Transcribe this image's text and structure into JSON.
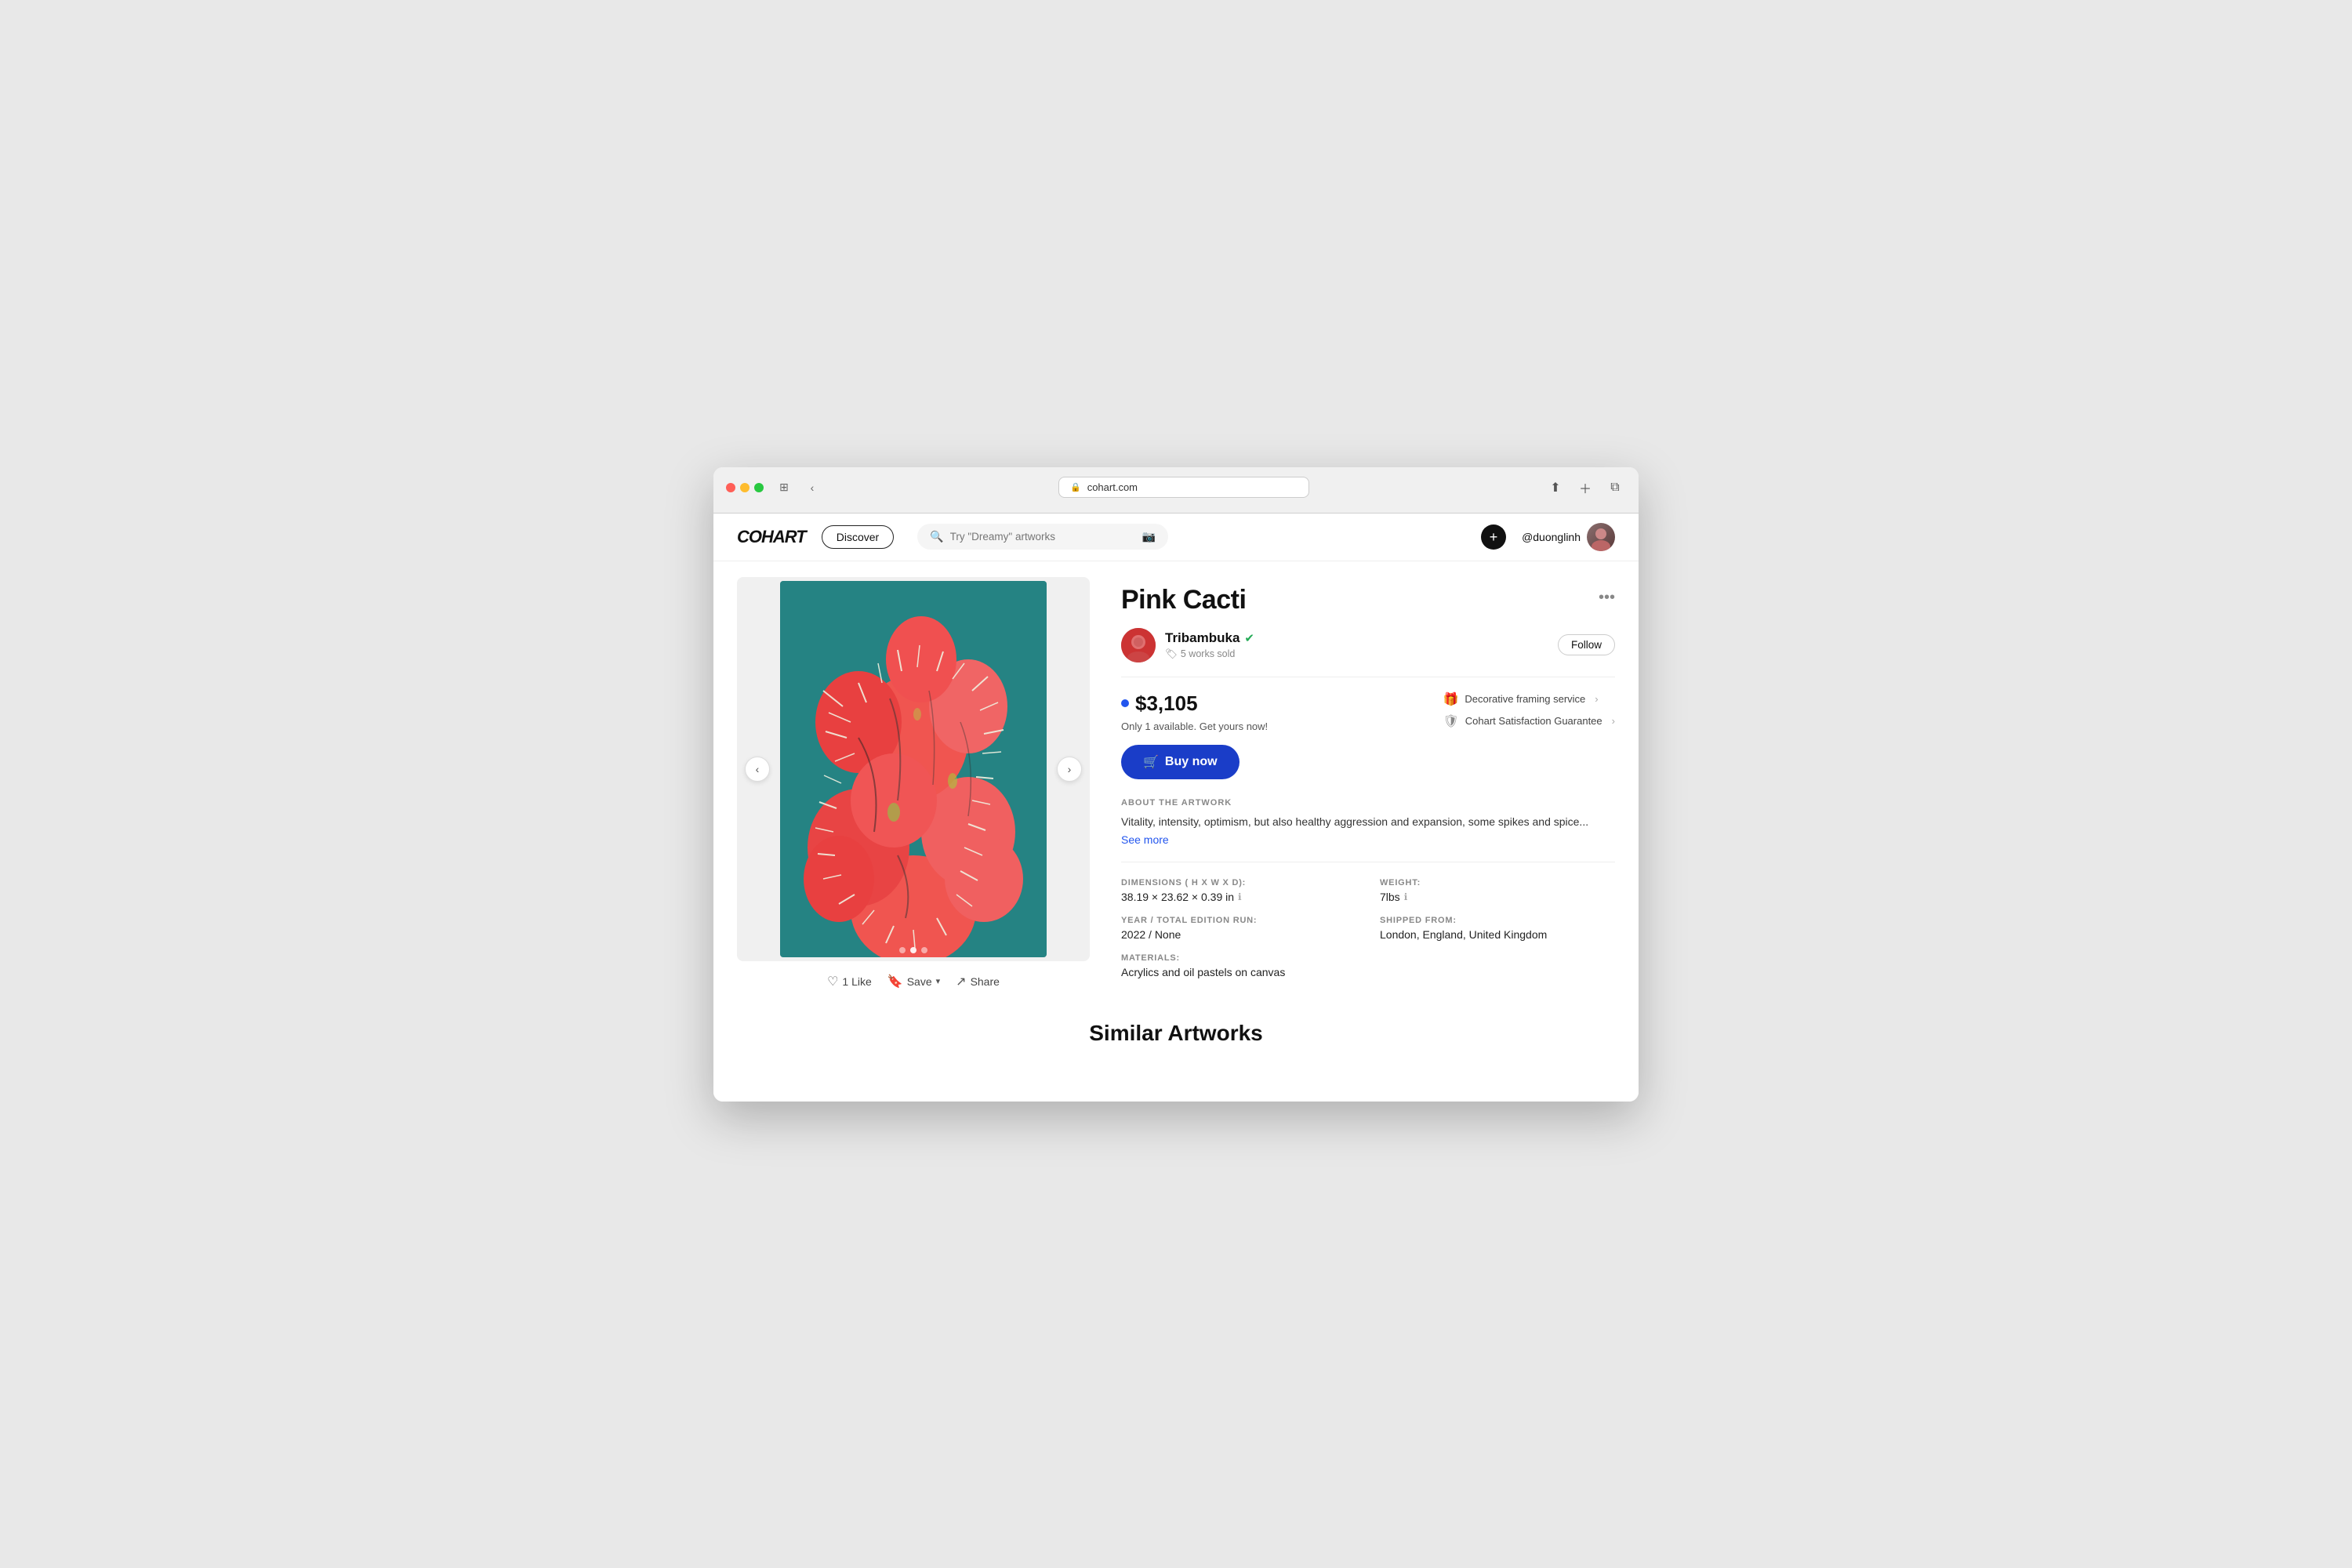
{
  "browser": {
    "url": "cohart.com",
    "more_label": "•••"
  },
  "nav": {
    "logo": "COHART",
    "discover_label": "Discover",
    "search_placeholder": "Try \"Dreamy\" artworks",
    "username": "@duonglinh",
    "plus_icon": "+"
  },
  "artwork": {
    "title": "Pink Cacti",
    "artist": {
      "name": "Tribambuka",
      "verified": true,
      "works_sold": "5 works sold",
      "follow_label": "Follow"
    },
    "price": "$3,105",
    "availability": "Only 1 available. Get yours now!",
    "buy_label": "Buy now",
    "services": [
      {
        "label": "Decorative framing service",
        "icon": "🎁"
      },
      {
        "label": "Cohart Satisfaction Guarantee",
        "icon": "🛡"
      }
    ],
    "about_label": "ABOUT THE ARTWORK",
    "about_text": "Vitality, intensity, optimism, but also healthy aggression and expansion, some spikes and spice...",
    "see_more": "See more",
    "more_icon": "•••",
    "actions": {
      "like_count": "1 Like",
      "save_label": "Save",
      "share_label": "Share"
    },
    "specs": {
      "dimensions_label": "DIMENSIONS ( H X W X D):",
      "dimensions_value": "38.19 × 23.62 × 0.39 in",
      "weight_label": "WEIGHT:",
      "weight_value": "7lbs",
      "year_label": "YEAR / TOTAL EDITION RUN:",
      "year_value": "2022 / None",
      "shipped_label": "SHIPPED FROM:",
      "shipped_value": "London, England, United Kingdom",
      "materials_label": "MATERIALS:",
      "materials_value": "Acrylics and oil pastels on canvas"
    }
  },
  "similar": {
    "title": "Similar Artworks"
  }
}
